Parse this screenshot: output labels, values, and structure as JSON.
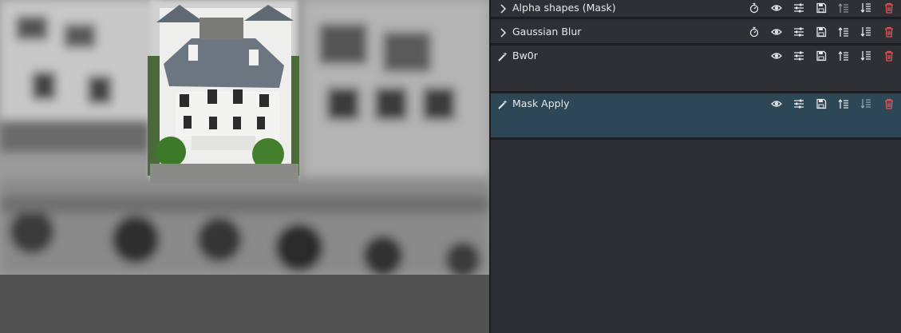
{
  "effects": [
    {
      "name": "Alpha shapes (Mask)",
      "lead_icon": "chevron-right-icon",
      "has_keyframe_icon": true,
      "selected": false
    },
    {
      "name": "Gaussian Blur",
      "lead_icon": "chevron-right-icon",
      "has_keyframe_icon": true,
      "selected": false
    },
    {
      "name": "Bw0r",
      "lead_icon": "wand-icon",
      "has_keyframe_icon": false,
      "selected": false
    },
    {
      "name": "Mask Apply",
      "lead_icon": "wand-icon",
      "has_keyframe_icon": false,
      "selected": true
    }
  ],
  "effect_buttons": [
    "keyframe-timer-icon",
    "eye-icon",
    "sliders-icon",
    "save-icon",
    "move-up-icon",
    "move-down-icon",
    "trash-icon"
  ],
  "colors": {
    "panel_bg": "#2b2d33",
    "row_bg": "#2e3036",
    "selected_row_bg": "#2e4756",
    "delete_icon": "#e0555a",
    "icon": "#e6e6e6"
  }
}
